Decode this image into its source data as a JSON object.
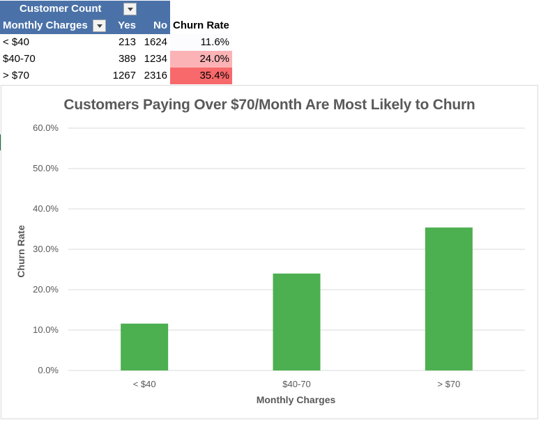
{
  "pivot": {
    "header_label": "Customer Count",
    "row_header": "Monthly Charges",
    "col_yes": "Yes",
    "col_no": "No",
    "col_rate": "Churn Rate",
    "rows": [
      {
        "label": "< $40",
        "yes": "213",
        "no": "1624",
        "rate": "11.6%",
        "fill": "#fcfcff"
      },
      {
        "label": "$40-70",
        "yes": "389",
        "no": "1234",
        "rate": "24.0%",
        "fill": "#fbb3b6"
      },
      {
        "label": "> $70",
        "yes": "1267",
        "no": "2316",
        "rate": "35.4%",
        "fill": "#f8696b"
      }
    ]
  },
  "chart_data": {
    "type": "bar",
    "title": "Customers Paying Over $70/Month Are Most Likely to Churn",
    "xlabel": "Monthly Charges",
    "ylabel": "Churn Rate",
    "categories": [
      "< $40",
      "$40-70",
      "> $70"
    ],
    "values": [
      11.6,
      24.0,
      35.4
    ],
    "ylim": [
      0,
      60
    ],
    "yticks": [
      "0.0%",
      "10.0%",
      "20.0%",
      "30.0%",
      "40.0%",
      "50.0%",
      "60.0%"
    ],
    "grid": true,
    "bar_color": "#4caf50",
    "grid_color": "#d9d9d9"
  }
}
